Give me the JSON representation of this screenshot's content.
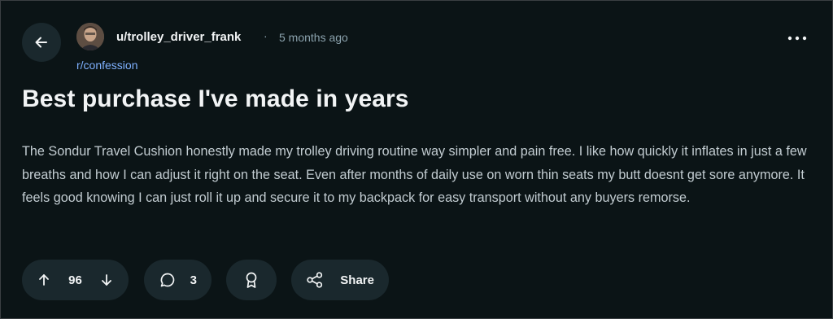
{
  "post": {
    "author": "u/trolley_driver_frank",
    "separator": "·",
    "time": "5 months ago",
    "subreddit": "r/confession",
    "title": "Best purchase I've made in years",
    "body": "The Sondur Travel Cushion honestly made my trolley driving routine way simpler and pain free. I like how quickly it inflates in just a few breaths and how I can adjust it right on the seat. Even after months of daily use on worn thin seats my butt doesnt get sore anymore. It feels good knowing I can just roll it up and secure it to my backpack for easy transport without any buyers remorse."
  },
  "actions": {
    "vote_count": "96",
    "comment_count": "3",
    "share_label": "Share"
  },
  "icons": {
    "back": "arrow-left-icon",
    "more": "more-horizontal-icon",
    "upvote": "arrow-up-icon",
    "downvote": "arrow-down-icon",
    "comment": "comment-bubble-icon",
    "award": "award-ribbon-icon",
    "share": "share-nodes-icon"
  },
  "colors": {
    "background": "#0b1416",
    "pill": "#1a282d",
    "text": "#f2f4f5",
    "muted": "#8ba2ad",
    "link": "#7fb1ff"
  }
}
